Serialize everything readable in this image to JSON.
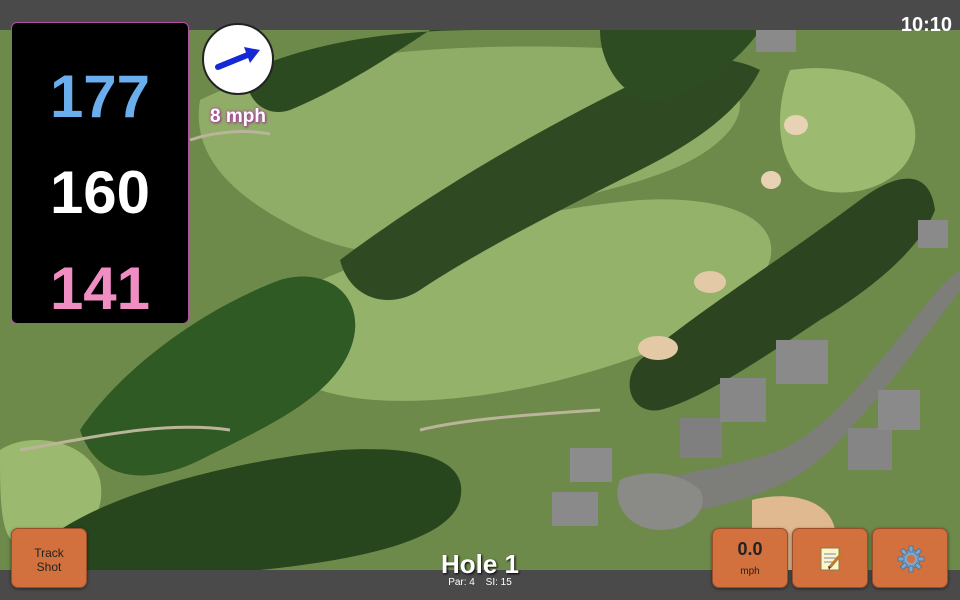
{
  "status": {
    "time": "10:10"
  },
  "distances": {
    "back": "177",
    "middle": "160",
    "front": "141"
  },
  "wind": {
    "speed_label": "8 mph",
    "direction_icon": "arrow-northeast-icon"
  },
  "buttons": {
    "track_line1": "Track",
    "track_line2": "Shot",
    "wind_value": "0.0",
    "wind_unit": "mph",
    "notes_icon": "notepad-icon",
    "settings_icon": "gear-icon"
  },
  "hole": {
    "title": "Hole 1",
    "par": "Par: 4",
    "si": "SI: 15"
  },
  "colors": {
    "back": "#6aaeee",
    "middle": "#ffffff",
    "front": "#f08ec4",
    "button": "#d2703e",
    "accent": "#b64fa8"
  }
}
